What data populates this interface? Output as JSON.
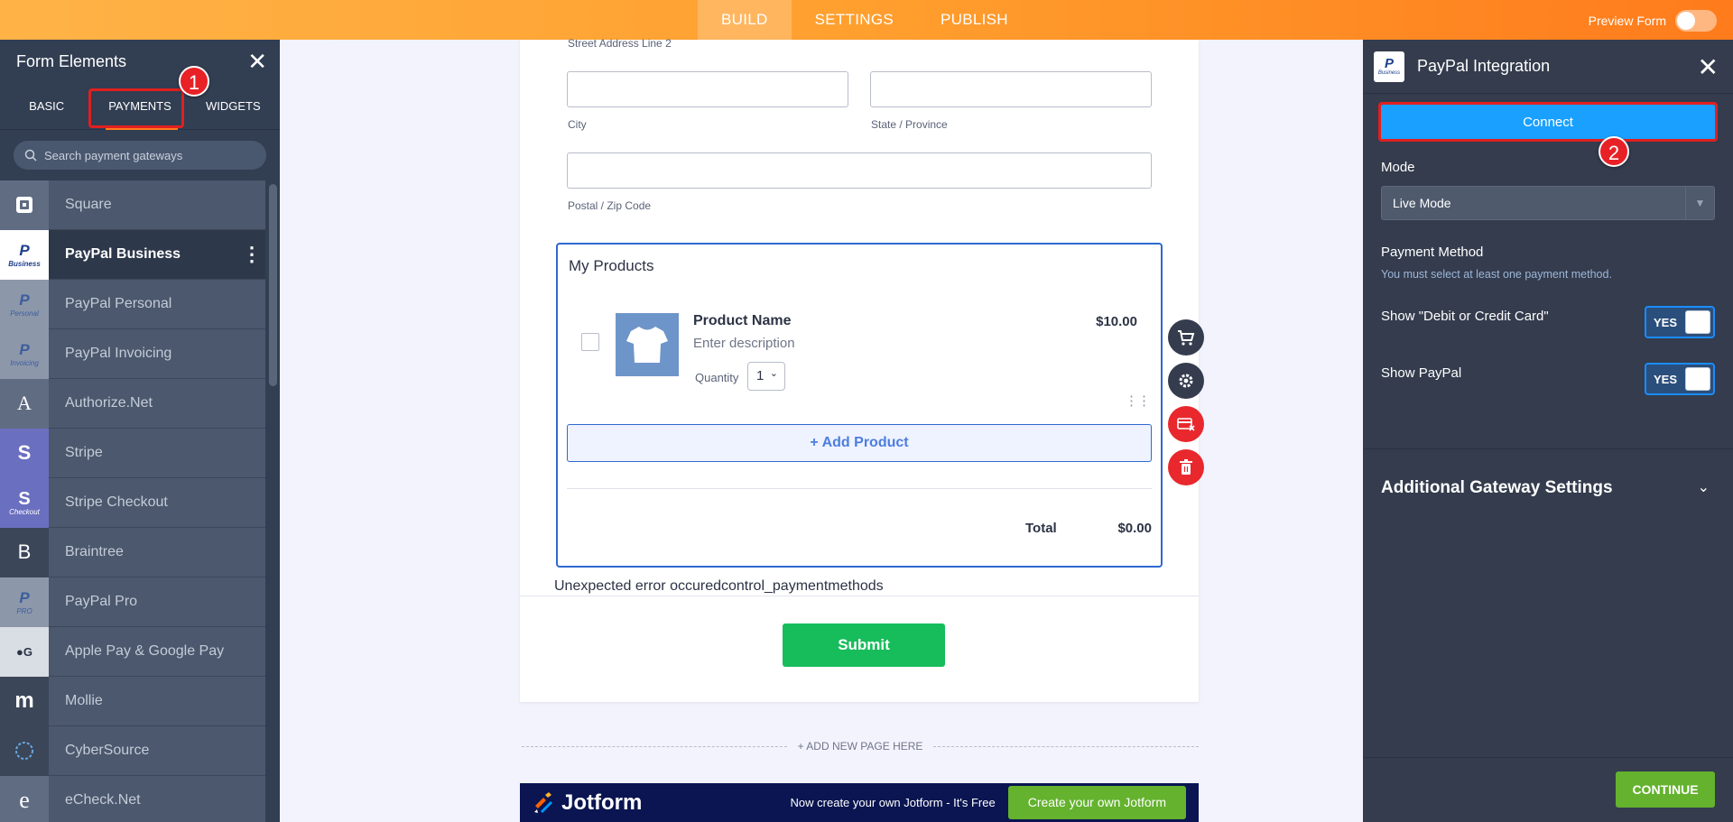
{
  "topbar": {
    "tabs": [
      "BUILD",
      "SETTINGS",
      "PUBLISH"
    ],
    "preview_label": "Preview Form"
  },
  "left_panel": {
    "title": "Form Elements",
    "tabs": [
      "BASIC",
      "PAYMENTS",
      "WIDGETS"
    ],
    "search_placeholder": "Search payment gateways",
    "gateways": [
      {
        "label": "Square",
        "icon": "square-icon"
      },
      {
        "label": "PayPal Business",
        "icon": "paypal-business-icon",
        "icon_caption": "Business"
      },
      {
        "label": "PayPal Personal",
        "icon": "paypal-personal-icon",
        "icon_caption": "Personal"
      },
      {
        "label": "PayPal Invoicing",
        "icon": "paypal-invoicing-icon",
        "icon_caption": "Invoicing"
      },
      {
        "label": "Authorize.Net",
        "icon": "authorize-net-icon",
        "glyph": "A"
      },
      {
        "label": "Stripe",
        "icon": "stripe-icon",
        "glyph": "S"
      },
      {
        "label": "Stripe Checkout",
        "icon": "stripe-checkout-icon",
        "glyph": "S",
        "icon_caption": "Checkout"
      },
      {
        "label": "Braintree",
        "icon": "braintree-icon",
        "glyph": "B"
      },
      {
        "label": "PayPal Pro",
        "icon": "paypal-pro-icon",
        "icon_caption": "PRO"
      },
      {
        "label": "Apple Pay & Google Pay",
        "icon": "apple-google-pay-icon"
      },
      {
        "label": "Mollie",
        "icon": "mollie-icon",
        "glyph": "m"
      },
      {
        "label": "CyberSource",
        "icon": "cybersource-icon"
      },
      {
        "label": "eCheck.Net",
        "icon": "echeck-net-icon",
        "glyph": "e"
      }
    ]
  },
  "annotations": {
    "badge1": "1",
    "badge2": "2"
  },
  "form": {
    "street2_label": "Street Address Line 2",
    "city_label": "City",
    "state_label": "State / Province",
    "postal_label": "Postal / Zip Code",
    "products_title": "My Products",
    "product": {
      "name": "Product Name",
      "description": "Enter description",
      "quantity_label": "Quantity",
      "quantity_value": "1",
      "price": "$10.00"
    },
    "add_product": "+ Add Product",
    "total_label": "Total",
    "total_value": "$0.00",
    "error_text": "Unexpected error occuredcontrol_paymentmethods",
    "submit_label": "Submit",
    "add_page": "+ ADD NEW PAGE HERE"
  },
  "banner": {
    "logo_text": "Jotform",
    "text": "Now create your own Jotform - It's Free",
    "button": "Create your own Jotform"
  },
  "right_panel": {
    "title": "PayPal Integration",
    "logo_caption": "Business",
    "connect_label": "Connect",
    "mode_label": "Mode",
    "mode_value": "Live Mode",
    "payment_method_label": "Payment Method",
    "payment_method_hint": "You must select at least one payment method.",
    "show_card_label": "Show \"Debit or Credit Card\"",
    "show_card_value": "YES",
    "show_paypal_label": "Show PayPal",
    "show_paypal_value": "YES",
    "additional_settings": "Additional Gateway Settings",
    "continue_label": "CONTINUE"
  },
  "colors": {
    "accent_orange": "#ff7b1c",
    "connect_blue": "#1aa0ff",
    "submit_green": "#18bd5b",
    "continue_green": "#64b22e",
    "annotation_red": "#e02020"
  }
}
